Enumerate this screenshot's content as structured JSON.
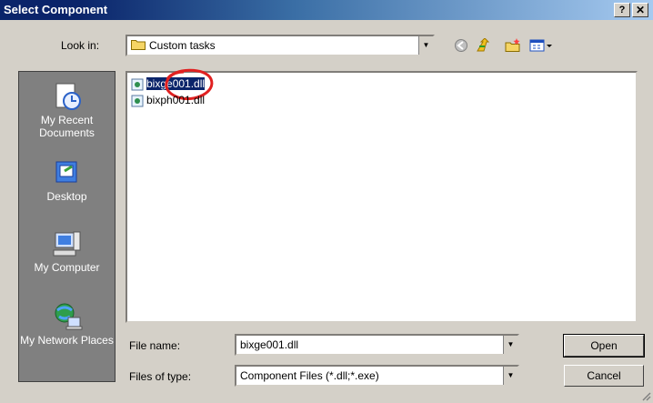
{
  "window": {
    "title": "Select Component",
    "help_label": "?",
    "close_label": "✕"
  },
  "lookin": {
    "label": "Look in:",
    "value": "Custom tasks"
  },
  "places": [
    {
      "label": "My Recent Documents",
      "icon": "recent-documents-icon"
    },
    {
      "label": "Desktop",
      "icon": "desktop-icon"
    },
    {
      "label": "My Computer",
      "icon": "my-computer-icon"
    },
    {
      "label": "My Network Places",
      "icon": "network-places-icon"
    }
  ],
  "files": [
    {
      "name": "bixge001.dll",
      "selected": true
    },
    {
      "name": "bixph001.dll",
      "selected": false
    }
  ],
  "filename": {
    "label": "File name:",
    "value": "bixge001.dll"
  },
  "filetype": {
    "label": "Files of type:",
    "value": "Component Files (*.dll;*.exe)"
  },
  "buttons": {
    "open": "Open",
    "cancel": "Cancel"
  },
  "colors": {
    "titlebar": "#0a246a",
    "selection": "#0a246a",
    "annotation": "#e02020"
  }
}
